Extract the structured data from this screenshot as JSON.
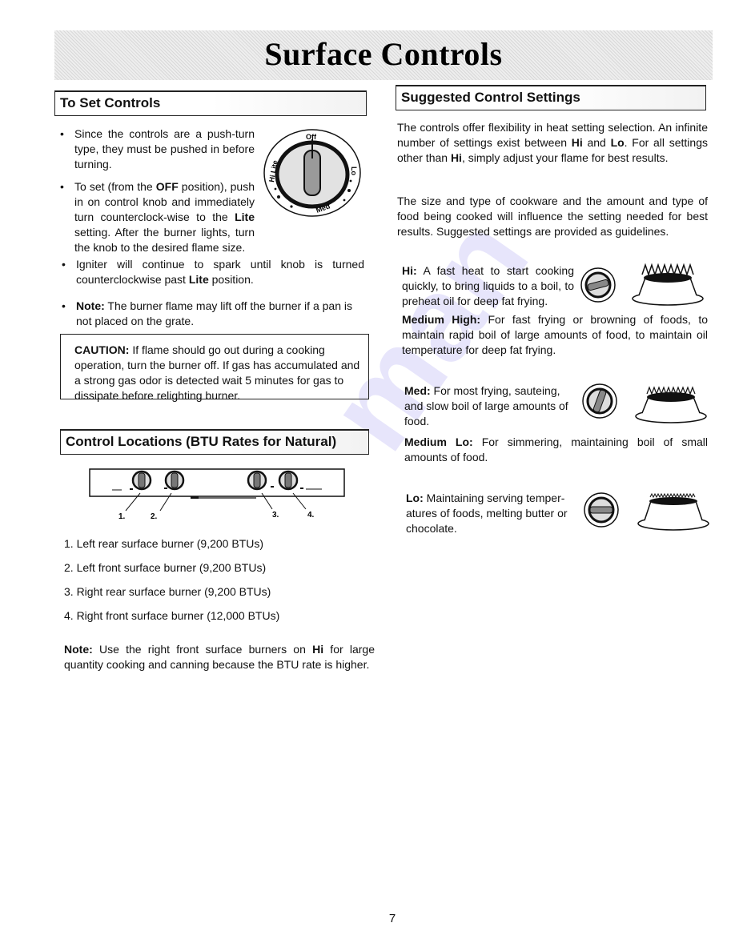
{
  "page": {
    "title": "Surface Controls",
    "page_number": "7"
  },
  "to_set_controls": {
    "heading": "To Set Controls",
    "bullet1": "Since the controls are a push-turn type, they must be pushed in before turning.",
    "bullet2_pre": "To set (from the ",
    "bullet2_b1": "OFF",
    "bullet2_mid": " position), push in on control knob and immediately turn counterclock-wise to the ",
    "bullet2_b2": "Lite",
    "bullet2_post": " setting. After the burner lights, turn the knob to the desired flame size.",
    "bullet3_pre": "Igniter will continue to spark until knob is turned counterclockwise past ",
    "bullet3_b": "Lite",
    "bullet3_post": " position.",
    "bullet4_b": "Note:",
    "bullet4_post": " The burner flame may lift off the burner if a pan is not placed on the grate.",
    "knob_labels": {
      "off": "Off",
      "hi_lite": "Hi Lite",
      "lo": "Lo",
      "med": "Med"
    }
  },
  "caution": {
    "label": "CAUTION:",
    "text": " If flame should go out during a cooking operation, turn the burner off. If gas has accumulated and a strong gas odor is detected wait 5 minutes for gas to dissipate before relighting burner."
  },
  "control_locations": {
    "heading": "Control Locations (BTU Rates for Natural)",
    "callouts": [
      "1.",
      "2.",
      "3.",
      "4."
    ],
    "items": [
      "1. Left rear surface burner (9,200 BTUs)",
      "2. Left front surface burner (9,200 BTUs)",
      "3. Right rear surface burner (9,200 BTUs)",
      "4. Right front surface burner (12,000 BTUs)"
    ],
    "note_label": "Note:",
    "note_pre": " Use the right front surface burners on ",
    "note_b": "Hi",
    "note_post": " for large quantity cooking and canning because the BTU rate is higher."
  },
  "suggested": {
    "heading": "Suggested Control Settings",
    "p1_a": "The controls offer flexibility in heat setting selection. An infinite number of settings exist between ",
    "p1_b1": "Hi",
    "p1_c": " and ",
    "p1_b2": "Lo",
    "p1_d": ". For all settings other than ",
    "p1_b3": "Hi",
    "p1_e": ", simply adjust your flame for best results.",
    "p2": "The size and type of cookware and the amount and type of food being cooked will influence the setting needed for best results. Suggested settings are provided as guidelines.",
    "settings": [
      {
        "label": "Hi:",
        "text": " A fast heat to start cooking quickly, to bring liquids to a boil, to preheat oil for deep fat frying."
      },
      {
        "label": "Medium High:",
        "text": " For fast frying or browning of foods, to maintain rapid boil of large amounts of food, to maintain oil temperature for deep fat frying."
      },
      {
        "label": "Med:",
        "text": " For most frying, sauteing, and slow boil of large amounts of food."
      },
      {
        "label": "Medium Lo:",
        "text": " For simmering, maintaining boil of small amounts of food."
      },
      {
        "label": "Lo:",
        "text": " Maintaining serving temper-atures of foods, melting butter or chocolate."
      }
    ]
  }
}
